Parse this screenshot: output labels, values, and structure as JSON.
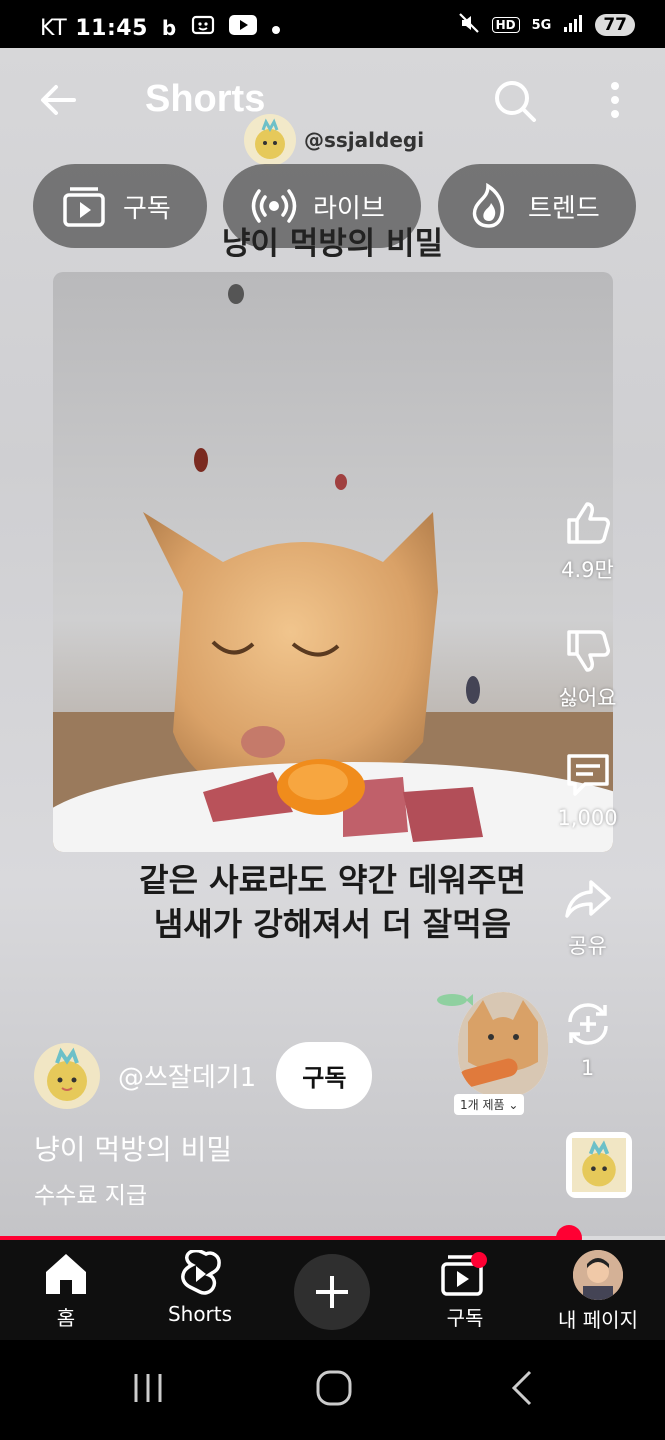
{
  "status_bar": {
    "carrier": "KT",
    "time": "11:45",
    "network": "5G",
    "hd": "HD",
    "battery": "77",
    "icons": [
      "b-icon",
      "screen-record-icon",
      "youtube-icon",
      "dot-icon",
      "mute-icon",
      "signal-icon"
    ]
  },
  "header": {
    "title": "Shorts",
    "watermark_handle": "@ssjaldegi"
  },
  "chips": [
    {
      "label": "구독",
      "icon": "subscriptions-icon"
    },
    {
      "label": "라이브",
      "icon": "live-icon"
    },
    {
      "label": "트렌드",
      "icon": "trending-flame-icon"
    }
  ],
  "video": {
    "overlay_title": "냥이 먹방의 비밀",
    "caption_line1": "같은 사료라도 약간 데워주면",
    "caption_line2": "냄새가 강해져서 더 잘먹음"
  },
  "actions": {
    "like_count": "4.9만",
    "dislike_label": "싫어요",
    "comment_count": "1,000",
    "share_label": "공유",
    "remix_count": "1"
  },
  "product": {
    "tag": "1개 제품 ⌄"
  },
  "channel": {
    "name": "@쓰잘데기1",
    "subscribe_label": "구독",
    "video_title": "냥이 먹방의 비밀",
    "commission_label": "수수료 지급"
  },
  "progress": {
    "fraction": 0.855
  },
  "bottom_nav": {
    "home": "홈",
    "shorts": "Shorts",
    "subscriptions": "구독",
    "my_page": "내 페이지"
  },
  "colors": {
    "accent": "#ff0033",
    "nav_bg": "#0f0f0f",
    "chip_bg": "#5f5f5f"
  }
}
